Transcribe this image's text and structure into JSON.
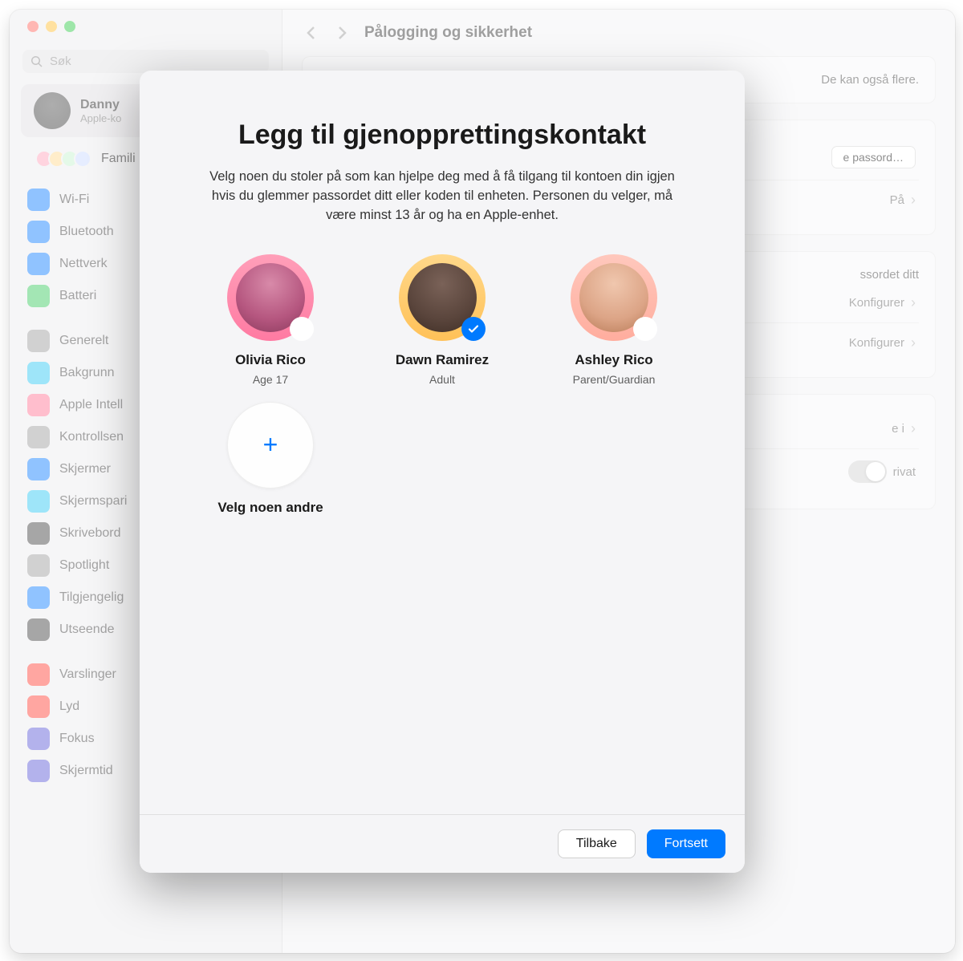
{
  "header": {
    "title": "Pålogging og sikkerhet"
  },
  "search": {
    "placeholder": "Søk"
  },
  "account": {
    "name": "Danny",
    "sub": "Apple-ko"
  },
  "family_label": "Famili",
  "sidebar": [
    {
      "label": "Wi-Fi",
      "color": "#0a7aff"
    },
    {
      "label": "Bluetooth",
      "color": "#0a7aff"
    },
    {
      "label": "Nettverk",
      "color": "#0a7aff"
    },
    {
      "label": "Batteri",
      "color": "#34c759"
    },
    {
      "sep": true
    },
    {
      "label": "Generelt",
      "color": "#9a9a9a"
    },
    {
      "label": "Bakgrunn",
      "color": "#28c6f1"
    },
    {
      "label": "Apple Intell",
      "color": "#ff6f91"
    },
    {
      "label": "Kontrollsen",
      "color": "#9a9a9a"
    },
    {
      "label": "Skjermer",
      "color": "#0a7aff"
    },
    {
      "label": "Skjermspari",
      "color": "#28c6f1"
    },
    {
      "label": "Skrivebord",
      "color": "#3a3a3a"
    },
    {
      "label": "Spotlight",
      "color": "#9a9a9a"
    },
    {
      "label": "Tilgjengelig",
      "color": "#0a7aff"
    },
    {
      "label": "Utseende",
      "color": "#3a3a3a"
    },
    {
      "sep": true
    },
    {
      "label": "Varslinger",
      "color": "#ff3b30"
    },
    {
      "label": "Lyd",
      "color": "#ff3b30"
    },
    {
      "label": "Fokus",
      "color": "#5856d6"
    },
    {
      "label": "Skjermtid",
      "color": "#5856d6"
    }
  ],
  "background": {
    "panel1_text": "De kan også flere.",
    "password_btn": "e passord…",
    "two_factor_value": "På",
    "recovery_text": "ssordet ditt",
    "config1": "Konfigurer",
    "config2": "Konfigurer",
    "row_label": "e i",
    "privat_label": "rivat"
  },
  "modal": {
    "title": "Legg til gjenopprettingskontakt",
    "description": "Velg noen du stoler på som kan hjelpe deg med å få tilgang til kontoen din igjen hvis du glemmer passordet ditt eller koden til enheten. Personen du velger, må være minst 13 år og ha en Apple-enhet.",
    "contacts": [
      {
        "name": "Olivia Rico",
        "sub": "Age 17",
        "selected": false
      },
      {
        "name": "Dawn Ramirez",
        "sub": "Adult",
        "selected": true
      },
      {
        "name": "Ashley Rico",
        "sub": "Parent/Guardian",
        "selected": false
      }
    ],
    "other_label": "Velg noen andre",
    "back_label": "Tilbake",
    "continue_label": "Fortsett"
  }
}
